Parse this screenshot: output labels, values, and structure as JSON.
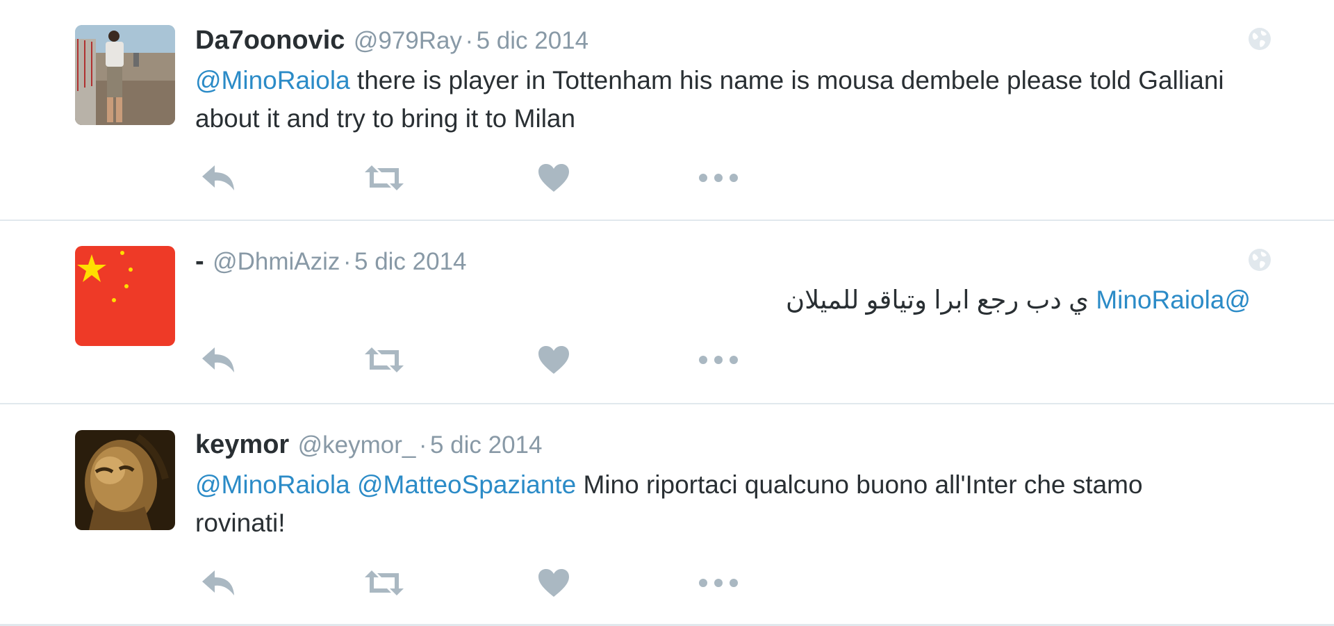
{
  "tweets": [
    {
      "fullname": "Da7oonovic",
      "username": "@979Ray",
      "separator": "·",
      "time": "5 dic 2014",
      "mentions": [
        "@MinoRaiola"
      ],
      "text": " there is player in Tottenham his name is mousa dembele please told Galliani about it and  try to bring it to Milan",
      "avatar": "person-on-beach-photo",
      "globe_icon": "globe-icon"
    },
    {
      "fullname": "-",
      "username": "@DhmiAziz",
      "separator": "·",
      "time": "5 dic 2014",
      "mentions": [
        "@MinoRaiola"
      ],
      "text": " ي دب رجع ابرا وتياقو للميلان",
      "avatar": "china-flag",
      "globe_icon": "globe-icon"
    },
    {
      "fullname": "keymor",
      "username": "@keymor_",
      "separator": "·",
      "time": "5 dic 2014",
      "mentions": [
        "@MinoRaiola",
        "@MatteoSpaziante"
      ],
      "text": " Mino riportaci qualcuno buono all'Inter che stamo rovinati!",
      "avatar": "old-man-painting"
    }
  ],
  "actions": [
    "reply-icon",
    "retweet-icon",
    "like-heart-icon",
    "more-dots-icon"
  ],
  "colors": {
    "link": "#2b8bc7",
    "muted": "#8899a6",
    "icon": "#aab8c2",
    "divider": "#e1e8ed",
    "flag_red": "#ee3a27",
    "flag_yellow": "#ffde00"
  }
}
